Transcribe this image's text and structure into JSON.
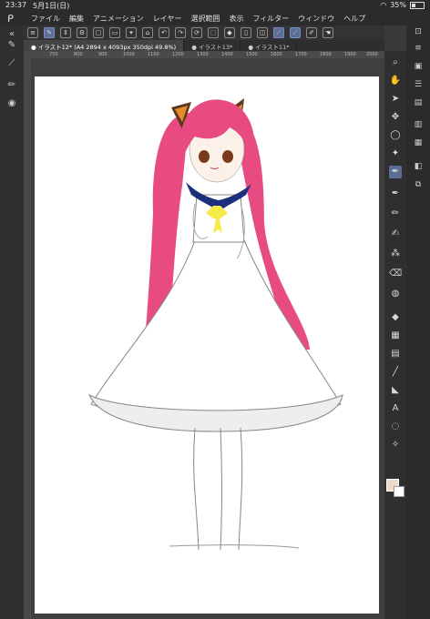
{
  "status": {
    "time": "23:37",
    "date": "5月1日(日)",
    "battery": "35%"
  },
  "menu": {
    "items": [
      "ファイル",
      "編集",
      "アニメーション",
      "レイヤー",
      "選択範囲",
      "表示",
      "フィルター",
      "ウィンドウ",
      "ヘルプ"
    ]
  },
  "tabs": [
    {
      "label": "● イラスト12* (A4 2894 x 4093px 350dpi 49.8%)"
    },
    {
      "label": "● イラスト13*"
    },
    {
      "label": "● イラスト11*"
    }
  ],
  "ruler": {
    "marks": [
      "700",
      "800",
      "900",
      "1000",
      "1100",
      "1200",
      "1300",
      "1400",
      "1500",
      "1600",
      "1700",
      "1800",
      "1900",
      "2000"
    ]
  },
  "colors": {
    "accent": "#5c6d96",
    "main_color": "#f1d9c8",
    "sub_color": "#ffffff",
    "hair": "#e84b82"
  }
}
